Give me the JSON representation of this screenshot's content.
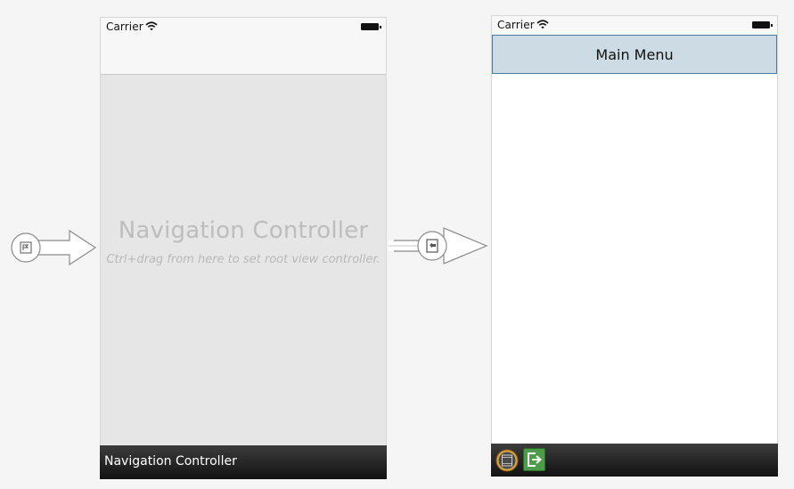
{
  "colors": {
    "canvas": "#f5f5f5",
    "placeholder_text": "#bdbdbd",
    "header_fill": "#ccdbe4",
    "header_border": "#4b7b9f",
    "dock_top": "#3c3c3c",
    "dock_bottom": "#121212",
    "exit_green": "#4c9c4c"
  },
  "entry_arrow": {
    "icon": "initial-view-controller-arrow",
    "badge_icon": "entry-point-icon"
  },
  "navigation_controller": {
    "status_bar": {
      "carrier": "Carrier",
      "wifi_icon": "wifi-icon",
      "battery_icon": "battery-icon"
    },
    "placeholder_title": "Navigation Controller",
    "placeholder_hint": "Ctrl+drag from here to set root view controller.",
    "dock_label": "Navigation Controller"
  },
  "root_segue": {
    "icon": "relationship-segue-arrow",
    "badge_icon": "root-view-controller-relationship-icon"
  },
  "main_menu_scene": {
    "status_bar": {
      "carrier": "Carrier",
      "wifi_icon": "wifi-icon",
      "battery_icon": "battery-icon"
    },
    "header_title": "Main Menu",
    "dock_icons": [
      "view-controller-icon",
      "exit-icon"
    ]
  }
}
